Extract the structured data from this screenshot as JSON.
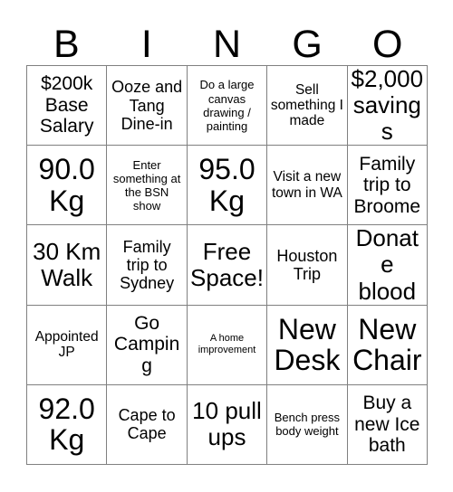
{
  "card": {
    "title": "BINGO",
    "header_letters": [
      "B",
      "I",
      "N",
      "G",
      "O"
    ],
    "grid_size": "5x5",
    "border_color": "#808080",
    "text_color": "#000000",
    "background_color": "#ffffff",
    "rows": [
      [
        {
          "text": "$200k Base Salary",
          "size": "xl"
        },
        {
          "text": "Ooze and Tang Dine-in",
          "size": "lg"
        },
        {
          "text": "Do a large canvas drawing / painting",
          "size": "sm"
        },
        {
          "text": "Sell something I made",
          "size": "md"
        },
        {
          "text": "$2,000 savings",
          "size": "xxl"
        }
      ],
      [
        {
          "text": "90.0 Kg",
          "size": "huge"
        },
        {
          "text": "Enter something at the BSN show",
          "size": "sm"
        },
        {
          "text": "95.0 Kg",
          "size": "huge"
        },
        {
          "text": "Visit a new town in WA",
          "size": "md"
        },
        {
          "text": "Family trip to Broome",
          "size": "xl"
        }
      ],
      [
        {
          "text": "30 Km Walk",
          "size": "xxl"
        },
        {
          "text": "Family trip to Sydney",
          "size": "lg"
        },
        {
          "text": "Free Space!",
          "size": "xxl"
        },
        {
          "text": "Houston Trip",
          "size": "lg"
        },
        {
          "text": "Donate blood",
          "size": "xxl"
        }
      ],
      [
        {
          "text": "Appointed JP",
          "size": "md"
        },
        {
          "text": "Go Camping",
          "size": "xl"
        },
        {
          "text": "A home improvement",
          "size": "xs"
        },
        {
          "text": "New Desk",
          "size": "huge"
        },
        {
          "text": "New Chair",
          "size": "huge"
        }
      ],
      [
        {
          "text": "92.0 Kg",
          "size": "huge"
        },
        {
          "text": "Cape to Cape",
          "size": "lg"
        },
        {
          "text": "10 pull ups",
          "size": "xxl"
        },
        {
          "text": "Bench press body weight",
          "size": "sm"
        },
        {
          "text": "Buy a new Ice bath",
          "size": "xl"
        }
      ]
    ]
  }
}
